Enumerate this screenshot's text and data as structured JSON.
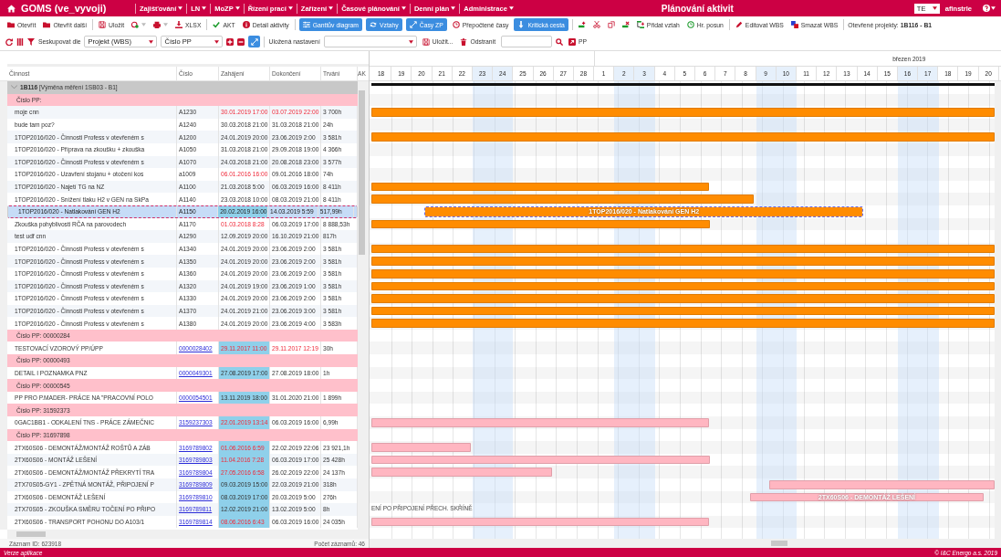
{
  "app": {
    "name": "GOMS (ve_vyvoji)",
    "menus": [
      "Zajišťování",
      "LN",
      "MoZP",
      "Řízení prací",
      "Zařízení",
      "Časové plánování",
      "Denní plán",
      "Administrace"
    ],
    "title": "Plánování aktivit",
    "language": "TE",
    "user": "afinstrle"
  },
  "toolbar": [
    {
      "kind": "button",
      "label": "Otevřít"
    },
    {
      "kind": "button",
      "label": "Otevřít další"
    },
    {
      "kind": "sep"
    },
    {
      "kind": "button",
      "label": "Uložit"
    },
    {
      "kind": "menu"
    },
    {
      "kind": "menu"
    },
    {
      "kind": "button",
      "label": "XLSX"
    },
    {
      "kind": "sep"
    },
    {
      "kind": "button",
      "label": "AKT"
    },
    {
      "kind": "button",
      "label": "Detail aktivity"
    },
    {
      "kind": "sep"
    },
    {
      "kind": "primary",
      "label": "Ganttův diagram"
    },
    {
      "kind": "primary",
      "label": "Vztahy"
    },
    {
      "kind": "primary",
      "label": "Časy ZP"
    },
    {
      "kind": "button",
      "label": "Přepočtené časy"
    },
    {
      "kind": "primary",
      "label": "Kritická cesta"
    },
    {
      "kind": "sep"
    },
    {
      "kind": "icon"
    },
    {
      "kind": "icon"
    },
    {
      "kind": "icon"
    },
    {
      "kind": "icon"
    },
    {
      "kind": "button",
      "label": "Přidat vztah"
    },
    {
      "kind": "button",
      "label": "Hr. posun"
    },
    {
      "kind": "sep"
    },
    {
      "kind": "button",
      "label": "Editovat WBS"
    },
    {
      "kind": "button",
      "label": "Smazat WBS"
    },
    {
      "kind": "sep"
    }
  ],
  "open_projects": {
    "label": "Otevřené projekty:",
    "value": "1B116 - B1"
  },
  "filterbar": {
    "group_by_label": "Seskupovat dle",
    "group_by": "Projekt (WBS)",
    "group_by_2": "Číslo PP",
    "saved_label": "Uložená nastavení",
    "save": "Uložit...",
    "delete": "Odstranit",
    "pp": "PP"
  },
  "table": {
    "columns": [
      "Činnost",
      "Číslo",
      "Zahájení",
      "Dokončení",
      "Trvání",
      "AK"
    ],
    "rows": [
      {
        "kind": "group",
        "label": "**1B116** [Výměna měření 1SB03 - B1]",
        "expanded": true,
        "color": "#111111"
      },
      {
        "kind": "pp",
        "label": "Číslo PP:"
      },
      {
        "kind": "task",
        "name": "moje cnn",
        "number": "A1230",
        "link": false,
        "start": "30.01.2019 17:00",
        "start_late": true,
        "start_mark": false,
        "end": "03.07.2019 22:00",
        "end_late": true,
        "duration": "3 700h",
        "selected": false,
        "color": "#ff8c00"
      },
      {
        "kind": "task",
        "name": "bude tam poz?",
        "number": "A1240",
        "link": false,
        "start": "30.03.2018 21:00",
        "start_late": false,
        "start_mark": false,
        "end": "31.03.2018 21:00",
        "end_late": false,
        "duration": "24h",
        "selected": false
      },
      {
        "kind": "task",
        "name": "1TOP2016/020 - Činnosti Profess v otevřeném s",
        "number": "A1200",
        "link": false,
        "start": "24.01.2019 20:00",
        "start_late": false,
        "start_mark": false,
        "end": "23.06.2019 2:00",
        "end_late": false,
        "duration": "3 581h",
        "selected": false,
        "color": "#ff8c00"
      },
      {
        "kind": "task",
        "name": "1TOP2016/020 - Příprava na zkoušku + zkouška",
        "number": "A1050",
        "link": false,
        "start": "31.03.2018 21:00",
        "start_late": false,
        "start_mark": false,
        "end": "29.09.2018 19:00",
        "end_late": false,
        "duration": "4 366h",
        "selected": false
      },
      {
        "kind": "task",
        "name": "1TOP2016/020 - Činnosti Profess v otevřeném s",
        "number": "A1070",
        "link": false,
        "start": "24.03.2018 21:00",
        "start_late": false,
        "start_mark": false,
        "end": "20.08.2018 23:00",
        "end_late": false,
        "duration": "3 577h",
        "selected": false
      },
      {
        "kind": "task",
        "name": "1TOP2016/020 - Uzavření stojanu + otočení kos",
        "number": "a1009",
        "link": false,
        "start": "06.01.2016 16:00",
        "start_late": true,
        "start_mark": false,
        "end": "09.01.2016 18:00",
        "end_late": false,
        "duration": "74h",
        "selected": false
      },
      {
        "kind": "task",
        "name": "1TOP2016/020 - Najetí TG na NZ",
        "number": "A1100",
        "link": false,
        "start": "21.03.2018 5:00",
        "start_late": false,
        "start_mark": false,
        "end": "06.03.2019 16:00",
        "end_late": false,
        "duration": "8 411h",
        "selected": false,
        "color": "#ff8c00"
      },
      {
        "kind": "task",
        "name": "1TOP2016/020 - Snížení tlaku H2 v GEN na SkPa",
        "number": "A1140",
        "link": false,
        "start": "23.03.2018 10:00",
        "start_late": false,
        "start_mark": false,
        "end": "08.03.2019 21:00",
        "end_late": false,
        "duration": "8 411h",
        "selected": false,
        "color": "#ff8c00"
      },
      {
        "kind": "task",
        "name": "1TOP2016/020 - Natlakování GEN H2",
        "number": "A1150",
        "link": false,
        "start": "20.02.2019 16:00",
        "start_late": false,
        "start_mark": true,
        "end": "14.03.2019 5:59",
        "end_late": false,
        "duration": "517,99h",
        "selected": true,
        "color": "#ff8c00",
        "bar_label": "1TOP2016/020 - Natlakování GEN H2"
      },
      {
        "kind": "task",
        "name": "Zkouška pohyblivosti RČA na parovodech",
        "number": "A1170",
        "link": false,
        "start": "01.03.2018 8:28",
        "start_late": true,
        "start_mark": false,
        "end": "06.03.2019 17:00",
        "end_late": false,
        "duration": "8 888,53h",
        "selected": false,
        "color": "#ff8c00"
      },
      {
        "kind": "task",
        "name": "test udf cnn",
        "number": "A1290",
        "link": false,
        "start": "12.09.2019 20:00",
        "start_late": false,
        "start_mark": false,
        "end": "16.10.2019 21:00",
        "end_late": false,
        "duration": "817h",
        "selected": false
      },
      {
        "kind": "task",
        "name": "1TOP2016/020 - Činnosti Profess v otevřeném s",
        "number": "A1340",
        "link": false,
        "start": "24.01.2019 20:00",
        "start_late": false,
        "start_mark": false,
        "end": "23.06.2019 2:00",
        "end_late": false,
        "duration": "3 581h",
        "selected": false,
        "color": "#ff8c00"
      },
      {
        "kind": "task",
        "name": "1TOP2016/020 - Činnosti Profess v otevřeném s",
        "number": "A1350",
        "link": false,
        "start": "24.01.2019 20:00",
        "start_late": false,
        "start_mark": false,
        "end": "23.06.2019 2:00",
        "end_late": false,
        "duration": "3 581h",
        "selected": false,
        "color": "#ff8c00"
      },
      {
        "kind": "task",
        "name": "1TOP2016/020 - Činnosti Profess v otevřeném s",
        "number": "A1360",
        "link": false,
        "start": "24.01.2019 20:00",
        "start_late": false,
        "start_mark": false,
        "end": "23.06.2019 2:00",
        "end_late": false,
        "duration": "3 581h",
        "selected": false,
        "color": "#ff8c00"
      },
      {
        "kind": "task",
        "name": "1TOP2016/020 - Činnosti Profess v otevřeném s",
        "number": "A1320",
        "link": false,
        "start": "24.01.2019 19:00",
        "start_late": false,
        "start_mark": false,
        "end": "23.06.2019 1:00",
        "end_late": false,
        "duration": "3 581h",
        "selected": false,
        "color": "#ff8c00"
      },
      {
        "kind": "task",
        "name": "1TOP2016/020 - Činnosti Profess v otevřeném s",
        "number": "A1330",
        "link": false,
        "start": "24.01.2019 20:00",
        "start_late": false,
        "start_mark": false,
        "end": "23.06.2019 2:00",
        "end_late": false,
        "duration": "3 581h",
        "selected": false,
        "color": "#ff8c00"
      },
      {
        "kind": "task",
        "name": "1TOP2016/020 - Činnosti Profess v otevřeném s",
        "number": "A1370",
        "link": false,
        "start": "24.01.2019 21:00",
        "start_late": false,
        "start_mark": false,
        "end": "23.06.2019 3:00",
        "end_late": false,
        "duration": "3 581h",
        "selected": false,
        "color": "#ff8c00"
      },
      {
        "kind": "task",
        "name": "1TOP2016/020 - Činnosti Profess v otevřeném s",
        "number": "A1380",
        "link": false,
        "start": "24.01.2019 20:00",
        "start_late": false,
        "start_mark": false,
        "end": "23.06.2019 4:00",
        "end_late": false,
        "duration": "3 583h",
        "selected": false,
        "color": "#ff8c00"
      },
      {
        "kind": "pp",
        "label": "Číslo PP: 00000284"
      },
      {
        "kind": "task",
        "name": "TESTOVACÍ VZOROVÝ PP/ÚPP",
        "number": "0000028402",
        "link": true,
        "start": "29.11.2017 11:00",
        "start_late": true,
        "start_mark": true,
        "end": "29.11.2017 12:19",
        "end_late": true,
        "duration": "30h",
        "selected": false
      },
      {
        "kind": "pp",
        "label": "Číslo PP: 00000493"
      },
      {
        "kind": "task",
        "name": "DETAIL I POZNAMKA PNZ",
        "number": "0000049301",
        "link": true,
        "start": "27.08.2019 17:00",
        "start_late": false,
        "start_mark": true,
        "end": "27.08.2019 18:00",
        "end_late": false,
        "duration": "1h",
        "selected": false
      },
      {
        "kind": "pp",
        "label": "Číslo PP: 00000545"
      },
      {
        "kind": "task",
        "name": "PP PRO P.MADER- PRÁCE NA \"PRACOVNÍ POLO",
        "number": "0000054501",
        "link": true,
        "start": "13.11.2019 18:00",
        "start_late": false,
        "start_mark": true,
        "end": "31.01.2020 21:00",
        "end_late": false,
        "duration": "1 899h",
        "selected": false
      },
      {
        "kind": "pp",
        "label": "Číslo PP: 31592373"
      },
      {
        "kind": "task",
        "name": "0GAC1BB1 - ODKALENÍ TNS - PRÁCE ZÁMEČNIC",
        "number": "3159237303",
        "link": true,
        "start": "22.01.2019 13:14",
        "start_late": true,
        "start_mark": true,
        "end": "06.03.2019 16:00",
        "end_late": false,
        "duration": "6,99h",
        "selected": false,
        "color": "#ffb6c1"
      },
      {
        "kind": "pp",
        "label": "Číslo PP: 31697898"
      },
      {
        "kind": "task",
        "name": "2TX60S06 - DEMONTÁŽ/MONTÁŽ ROŠTŮ A ZÁB",
        "number": "3169789802",
        "link": true,
        "start": "01.06.2016 6:59",
        "start_late": true,
        "start_mark": true,
        "end": "22.02.2019 22:06",
        "end_late": false,
        "duration": "23 921,1h",
        "selected": false,
        "color": "#ffb6c1"
      },
      {
        "kind": "task",
        "name": "2TX60S06 - MONTÁŽ LEŠENÍ",
        "number": "3169789803",
        "link": true,
        "start": "11.04.2016 7:28",
        "start_late": true,
        "start_mark": true,
        "end": "06.03.2019 17:00",
        "end_late": false,
        "duration": "25 428h",
        "selected": false,
        "color": "#ffb6c1"
      },
      {
        "kind": "task",
        "name": "2TX60S06 - DEMONTÁŽ/MONTÁŽ PŘEKRYTÍ TRA",
        "number": "3169789804",
        "link": true,
        "start": "27.05.2016 6:58",
        "start_late": true,
        "start_mark": true,
        "end": "26.02.2019 22:00",
        "end_late": false,
        "duration": "24 137h",
        "selected": false,
        "color": "#ffb6c1"
      },
      {
        "kind": "task",
        "name": "2TX70S05-GY1 - ZPĚTNÁ MONTÁŽ, PŘIPOJENÍ P",
        "number": "3169789809",
        "link": true,
        "start": "09.03.2019 15:00",
        "start_late": false,
        "start_mark": true,
        "end": "22.03.2019 21:00",
        "end_late": false,
        "duration": "318h",
        "selected": false,
        "color": "#ffb6c1"
      },
      {
        "kind": "task",
        "name": "2TX60S06 - DEMONTÁŽ LEŠENÍ",
        "number": "3169789810",
        "link": true,
        "start": "08.03.2019 17:00",
        "start_late": false,
        "start_mark": true,
        "end": "20.03.2019 5:00",
        "end_late": false,
        "duration": "276h",
        "selected": false,
        "color": "#ffb6c1",
        "bar_label": "2TX60S06 - DEMONTÁŽ LEŠENÍ"
      },
      {
        "kind": "task",
        "name": "2TX70S05 - ZKOUŠKA SMĚRU TOČENÍ PO PŘIPO",
        "number": "3169789811",
        "link": true,
        "start": "12.02.2019 21:00",
        "start_late": false,
        "start_mark": true,
        "end": "13.02.2019 5:00",
        "end_late": false,
        "duration": "8h",
        "selected": false,
        "gantt_label": "ENÍ PO PŘIPOJENÍ PŘECH. SKŘÍNĚ"
      },
      {
        "kind": "task",
        "name": "2TX60S06 - TRANSPORT POHONU DO A103/1",
        "number": "3169789814",
        "link": true,
        "start": "08.06.2016 6:43",
        "start_late": true,
        "start_mark": true,
        "end": "06.03.2019 16:00",
        "end_late": false,
        "duration": "24 035h",
        "selected": false,
        "color": "#ffb6c1"
      }
    ]
  },
  "gantt": {
    "month": "březen 2019",
    "days": [
      {
        "label": "18",
        "weekend": false
      },
      {
        "label": "19",
        "weekend": false
      },
      {
        "label": "20",
        "weekend": false
      },
      {
        "label": "21",
        "weekend": false
      },
      {
        "label": "22",
        "weekend": false
      },
      {
        "label": "23",
        "weekend": true
      },
      {
        "label": "24",
        "weekend": true
      },
      {
        "label": "25",
        "weekend": false
      },
      {
        "label": "26",
        "weekend": false
      },
      {
        "label": "27",
        "weekend": false
      },
      {
        "label": "28",
        "weekend": false
      },
      {
        "label": "1",
        "weekend": false
      },
      {
        "label": "2",
        "weekend": true
      },
      {
        "label": "3",
        "weekend": true
      },
      {
        "label": "4",
        "weekend": false
      },
      {
        "label": "5",
        "weekend": false
      },
      {
        "label": "6",
        "weekend": false
      },
      {
        "label": "7",
        "weekend": false
      },
      {
        "label": "8",
        "weekend": false
      },
      {
        "label": "9",
        "weekend": true
      },
      {
        "label": "10",
        "weekend": true
      },
      {
        "label": "11",
        "weekend": false
      },
      {
        "label": "12",
        "weekend": false
      },
      {
        "label": "13",
        "weekend": false
      },
      {
        "label": "14",
        "weekend": false
      },
      {
        "label": "15",
        "weekend": false
      },
      {
        "label": "16",
        "weekend": true
      },
      {
        "label": "17",
        "weekend": true
      },
      {
        "label": "18",
        "weekend": false
      },
      {
        "label": "19",
        "weekend": false
      },
      {
        "label": "20",
        "weekend": false
      }
    ]
  },
  "status": {
    "record": "Záznam ID: 623918",
    "count": "Počet záznamů: 46"
  },
  "footer": {
    "version": "Verze aplikace",
    "copyright": "© I&C Energo a.s. 2019"
  }
}
